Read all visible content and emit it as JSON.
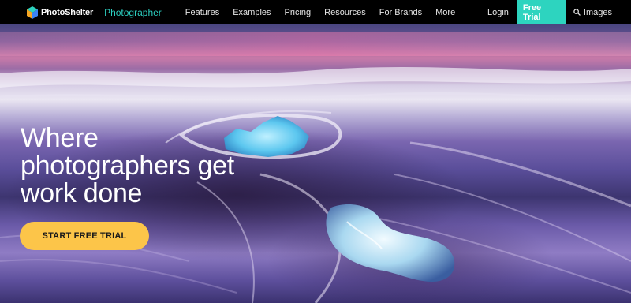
{
  "brand": {
    "name": "PhotoShelter",
    "sub": "Photographer",
    "logo_icon": "photoshelter-logo-icon"
  },
  "nav": {
    "items": [
      {
        "label": "Features"
      },
      {
        "label": "Examples"
      },
      {
        "label": "Pricing"
      },
      {
        "label": "Resources"
      },
      {
        "label": "For Brands"
      },
      {
        "label": "More"
      }
    ],
    "login": "Login",
    "free_trial": "Free Trial",
    "images": "Images",
    "images_icon": "search-icon"
  },
  "hero": {
    "headline_lines": [
      "Where",
      "photographers get",
      "work done"
    ],
    "cta": "START FREE TRIAL"
  },
  "colors": {
    "accent_teal": "#2dd4bf",
    "brand_sub_teal": "#2ccfc0",
    "cta_yellow": "#fcc549",
    "nav_bg": "#000000"
  }
}
